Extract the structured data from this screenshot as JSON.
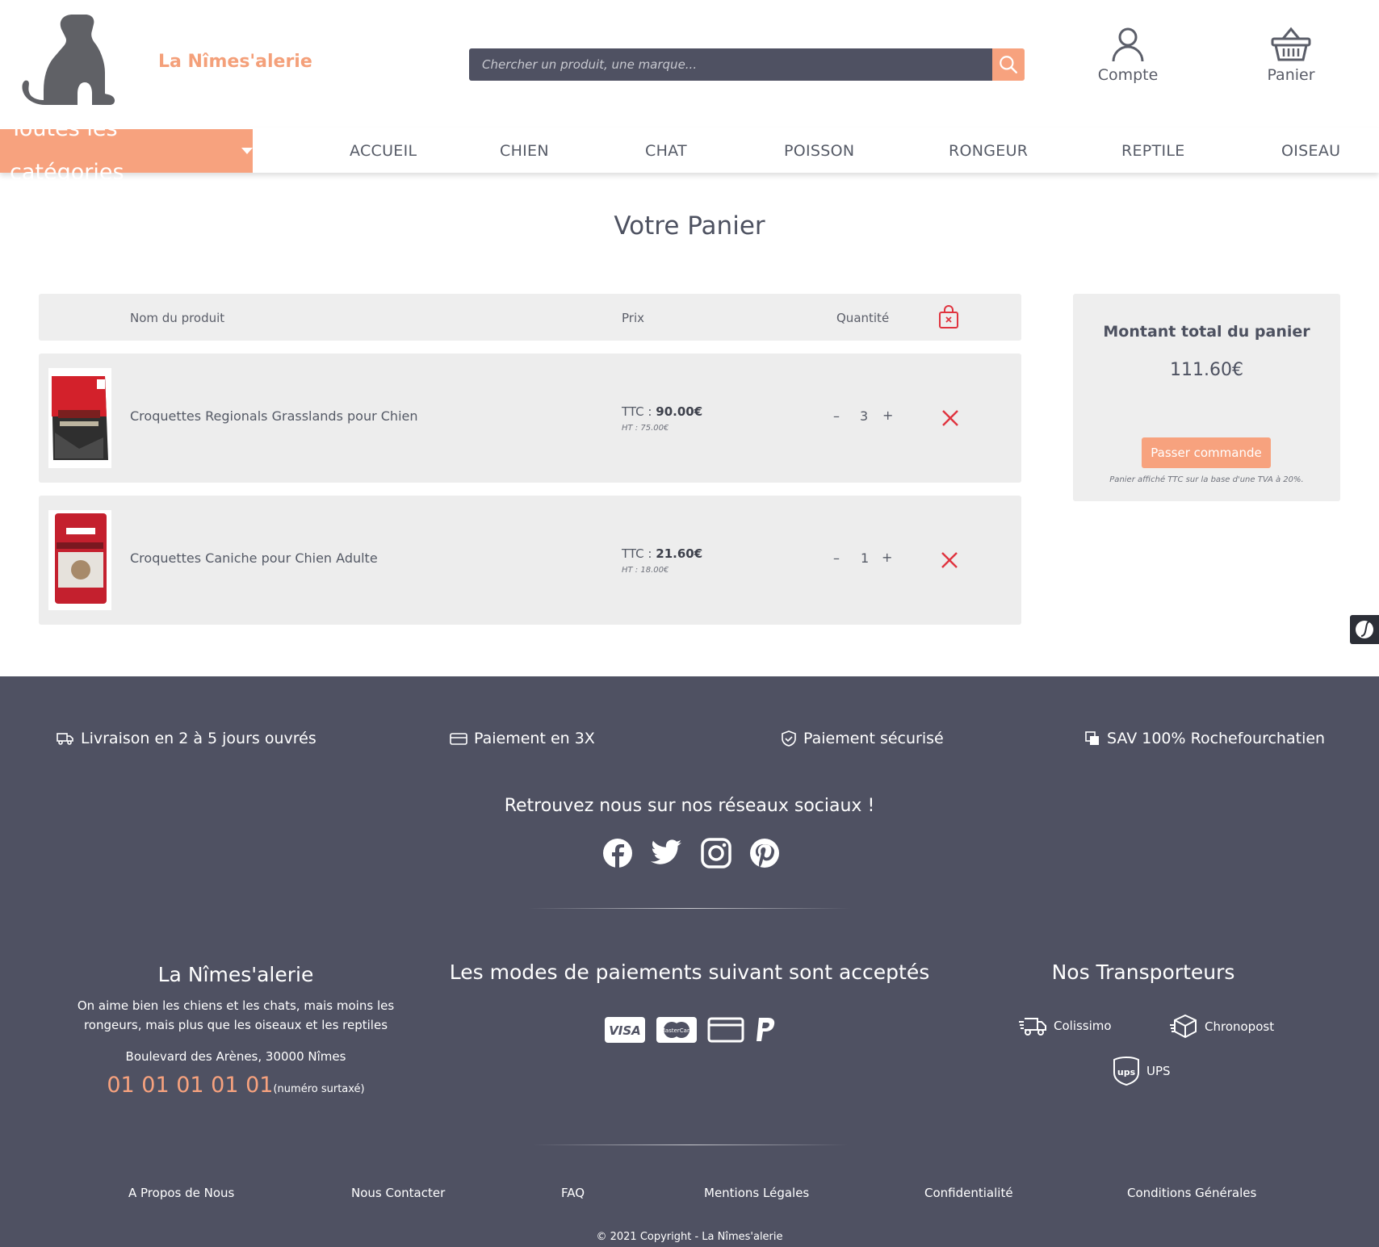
{
  "header": {
    "brand": "La Nîmes'alerie",
    "search_placeholder": "Chercher un produit, une marque...",
    "account_label": "Compte",
    "cart_label": "Panier"
  },
  "nav": {
    "categories_label": "Toutes les catégories",
    "items": [
      "ACCUEIL",
      "CHIEN",
      "CHAT",
      "POISSON",
      "RONGEUR",
      "REPTILE",
      "OISEAU"
    ]
  },
  "cart": {
    "title": "Votre Panier",
    "columns": {
      "product": "Nom du produit",
      "price": "Prix",
      "quantity": "Quantité"
    },
    "items": [
      {
        "name": "Croquettes Regionals Grasslands pour Chien",
        "ttc_label": "TTC :",
        "ttc": "90.00€",
        "ht": "HT : 75.00€",
        "qty": "3",
        "minus": "–",
        "plus": "+"
      },
      {
        "name": "Croquettes Caniche pour Chien Adulte",
        "ttc_label": "TTC :",
        "ttc": "21.60€",
        "ht": "HT : 18.00€",
        "qty": "1",
        "minus": "–",
        "plus": "+"
      }
    ]
  },
  "summary": {
    "title": "Montant total du panier",
    "total": "111.60€",
    "order_button": "Passer commande",
    "note": "Panier affiché TTC sur la base d'une TVA à 20%."
  },
  "footer": {
    "features": [
      "Livraison en 2 à 5 jours ouvrés",
      "Paiement en 3X",
      "Paiement sécurisé",
      "SAV 100% Rochefourchatien"
    ],
    "social_title": "Retrouvez nous sur nos réseaux sociaux !",
    "about_title": "La Nîmes'alerie",
    "about_text_1": "On aime bien les chiens et les chats, mais moins les",
    "about_text_2": "rongeurs, mais plus que les oiseaux et les reptiles",
    "address": "Boulevard des Arènes, 30000 Nîmes",
    "phone": "01 01 01 01 01",
    "phone_note": "(numéro surtaxé)",
    "payments_title": "Les modes de paiements suivant sont acceptés",
    "payment_visa": "VISA",
    "payment_mastercard": "MasterCard",
    "carriers_title": "Nos Transporteurs",
    "carriers": [
      "Colissimo",
      "Chronopost",
      "UPS"
    ],
    "carrier_ups_logo": "ups",
    "links": [
      "A Propos de Nous",
      "Nous Contacter",
      "FAQ",
      "Mentions Légales",
      "Confidentialité",
      "Conditions Générales"
    ],
    "copyright": "© 2021 Copyright - La Nîmes'alerie"
  },
  "colors": {
    "accent": "#f7a27e",
    "footer_bg": "#4f5162",
    "remove": "#e0343f",
    "panel": "#eeeeee"
  }
}
